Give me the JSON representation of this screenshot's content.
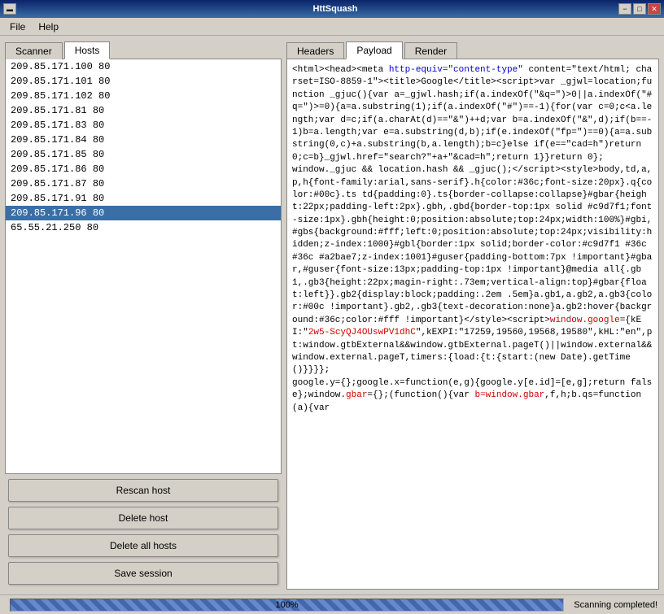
{
  "titlebar": {
    "title": "HttSquash",
    "minimize_label": "−",
    "maximize_label": "□",
    "close_label": "✕"
  },
  "menubar": {
    "items": [
      {
        "label": "File",
        "id": "file"
      },
      {
        "label": "Help",
        "id": "help"
      }
    ]
  },
  "left_panel": {
    "tabs": [
      {
        "label": "Scanner",
        "id": "scanner",
        "active": false
      },
      {
        "label": "Hosts",
        "id": "hosts",
        "active": true
      }
    ],
    "hosts": [
      {
        "ip": "209.85.171.100",
        "port": "80",
        "selected": false
      },
      {
        "ip": "209.85.171.101",
        "port": "80",
        "selected": false
      },
      {
        "ip": "209.85.171.102",
        "port": "80",
        "selected": false
      },
      {
        "ip": "209.85.171.81",
        "port": "80",
        "selected": false
      },
      {
        "ip": "209.85.171.83",
        "port": "80",
        "selected": false
      },
      {
        "ip": "209.85.171.84",
        "port": "80",
        "selected": false
      },
      {
        "ip": "209.85.171.85",
        "port": "80",
        "selected": false
      },
      {
        "ip": "209.85.171.86",
        "port": "80",
        "selected": false
      },
      {
        "ip": "209.85.171.87",
        "port": "80",
        "selected": false
      },
      {
        "ip": "209.85.171.91",
        "port": "80",
        "selected": false
      },
      {
        "ip": "209.85.171.96",
        "port": "80",
        "selected": true
      },
      {
        "ip": "65.55.21.250",
        "port": "80",
        "selected": false
      }
    ],
    "buttons": [
      {
        "label": "Rescan host",
        "id": "rescan-host"
      },
      {
        "label": "Delete host",
        "id": "delete-host"
      },
      {
        "label": "Delete all hosts",
        "id": "delete-all-hosts"
      },
      {
        "label": "Save session",
        "id": "save-session"
      }
    ]
  },
  "right_panel": {
    "tabs": [
      {
        "label": "Headers",
        "id": "headers",
        "active": false
      },
      {
        "label": "Payload",
        "id": "payload",
        "active": true
      },
      {
        "label": "Render",
        "id": "render",
        "active": false
      }
    ]
  },
  "statusbar": {
    "progress": 100,
    "progress_label": "100%",
    "status_text": "Scanning completed!"
  }
}
